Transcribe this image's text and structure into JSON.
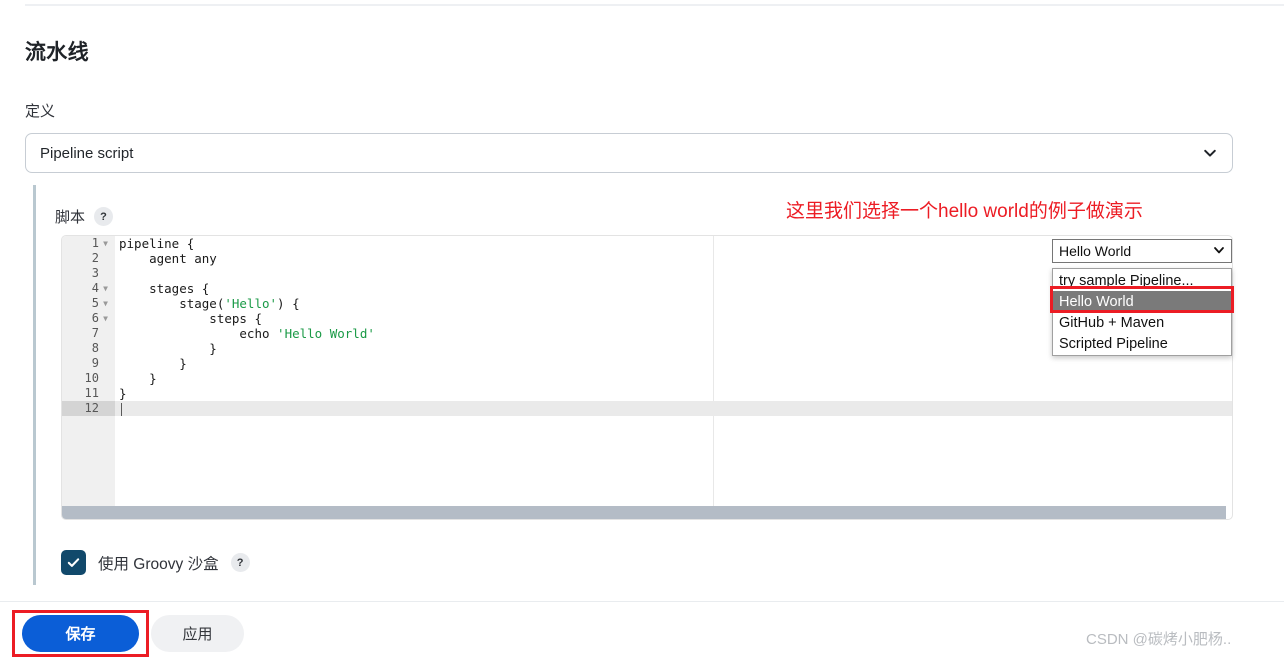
{
  "page": {
    "title": "流水线"
  },
  "definition": {
    "label": "定义",
    "selected": "Pipeline script",
    "chevron_icon": "chevron-down-icon"
  },
  "script": {
    "label": "脚本",
    "help_label": "?",
    "code_lines": [
      {
        "num": "1",
        "fold": true,
        "segments": [
          {
            "t": "pipeline {",
            "style": "plain"
          }
        ]
      },
      {
        "num": "2",
        "fold": false,
        "segments": [
          {
            "t": "    agent any",
            "style": "plain"
          }
        ]
      },
      {
        "num": "3",
        "fold": false,
        "segments": [
          {
            "t": "",
            "style": "plain"
          }
        ]
      },
      {
        "num": "4",
        "fold": true,
        "segments": [
          {
            "t": "    stages {",
            "style": "plain"
          }
        ]
      },
      {
        "num": "5",
        "fold": true,
        "segments": [
          {
            "t": "        stage(",
            "style": "plain"
          },
          {
            "t": "'Hello'",
            "style": "str"
          },
          {
            "t": ") {",
            "style": "plain"
          }
        ]
      },
      {
        "num": "6",
        "fold": true,
        "segments": [
          {
            "t": "            steps {",
            "style": "plain"
          }
        ]
      },
      {
        "num": "7",
        "fold": false,
        "segments": [
          {
            "t": "                echo ",
            "style": "plain"
          },
          {
            "t": "'Hello World'",
            "style": "str"
          }
        ]
      },
      {
        "num": "8",
        "fold": false,
        "segments": [
          {
            "t": "            }",
            "style": "plain"
          }
        ]
      },
      {
        "num": "9",
        "fold": false,
        "segments": [
          {
            "t": "        }",
            "style": "plain"
          }
        ]
      },
      {
        "num": "10",
        "fold": false,
        "segments": [
          {
            "t": "    }",
            "style": "plain"
          }
        ]
      },
      {
        "num": "11",
        "fold": false,
        "segments": [
          {
            "t": "}",
            "style": "plain"
          }
        ]
      },
      {
        "num": "12",
        "fold": false,
        "active": true,
        "segments": [
          {
            "t": "",
            "style": "plain"
          }
        ]
      }
    ]
  },
  "sample_dropdown": {
    "selected": "Hello World",
    "chevron_icon": "chevron-down-icon",
    "options": [
      {
        "label": "try sample Pipeline...",
        "selected": false
      },
      {
        "label": "Hello World",
        "selected": true
      },
      {
        "label": "GitHub + Maven",
        "selected": false
      },
      {
        "label": "Scripted Pipeline",
        "selected": false
      }
    ]
  },
  "annotations": {
    "note": "这里我们选择一个hello world的例子做演示",
    "color": "#ec1c24"
  },
  "sandbox": {
    "label": "使用 Groovy 沙盒",
    "checked": true,
    "help_label": "?",
    "check_color": "#11496b"
  },
  "footer": {
    "save_label": "保存",
    "apply_label": "应用",
    "save_color": "#0b5ed7"
  },
  "watermark": {
    "text": "CSDN @碳烤小肥杨.."
  }
}
